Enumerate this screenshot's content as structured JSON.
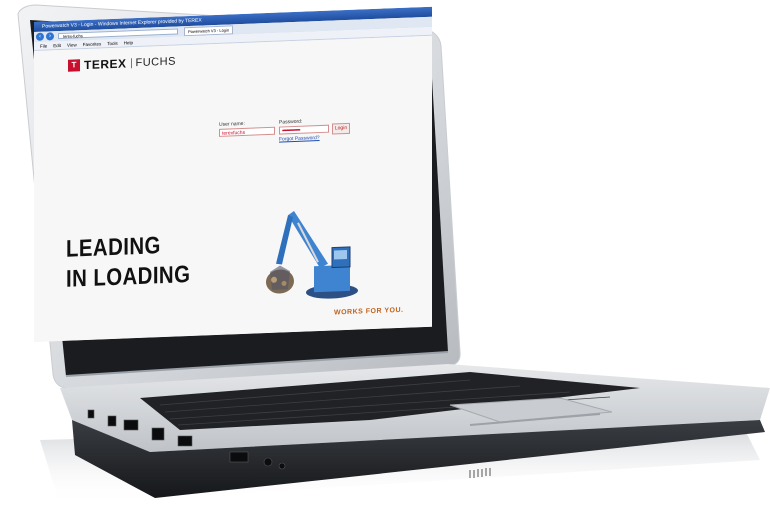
{
  "browser": {
    "window_title": "Powerwatch V3 - Login - Windows Internet Explorer provided by TEREX",
    "address_url": "terex-fuchs",
    "tab_label": "Powerwatch V3 - Login",
    "menu": [
      "File",
      "Edit",
      "View",
      "Favorites",
      "Tools",
      "Help"
    ]
  },
  "brand": {
    "badge": "T",
    "terex": "TEREX",
    "fuchs": "FUCHS",
    "accent": "#c8102e"
  },
  "login": {
    "username_label": "User name:",
    "username_value": "terexfuchs",
    "password_label": "Password:",
    "password_value": "••••••••••••••••",
    "login_button": "Login",
    "forgot_link": "Forgot Password?"
  },
  "slogan": {
    "line1": "LEADING",
    "line2": "IN LOADING",
    "tagline": "WORKS FOR YOU."
  }
}
